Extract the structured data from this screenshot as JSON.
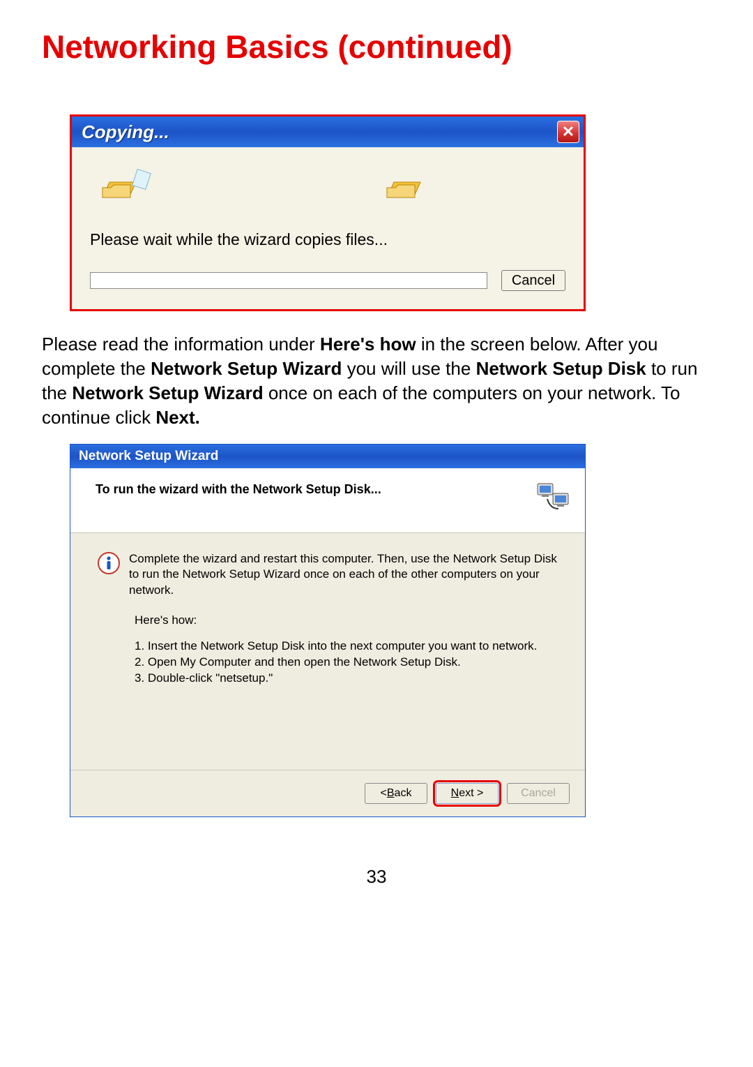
{
  "section_title": "Networking Basics (continued)",
  "copying_dialog": {
    "title": "Copying...",
    "message": "Please wait while the wizard copies files...",
    "cancel_label": "Cancel"
  },
  "paragraph": {
    "pre1": "Please read the information under ",
    "b1": "Here's how",
    "mid1": " in the screen below. After you complete the ",
    "b2": "Network Setup Wizard",
    "mid2": " you will use the ",
    "b3": "Network Setup Disk",
    "mid3": " to run the ",
    "b4": "Network Setup Wizard",
    "mid4": " once on each of the computers on your network. To continue click ",
    "b5": "Next.",
    "tail": ""
  },
  "nsw_dialog": {
    "window_title": "Network Setup Wizard",
    "header": "To run the wizard with the Network Setup Disk...",
    "info_text": "Complete the wizard and restart this computer. Then, use the Network Setup Disk to run the Network Setup Wizard once on each of the other computers on your network.",
    "heres_how": "Here's how:",
    "step1": "1.  Insert the Network Setup Disk into the next computer you want to network.",
    "step2": "2.  Open My Computer and then open the Network Setup Disk.",
    "step3": "3.  Double-click \"netsetup.\"",
    "back_label": "< Back",
    "next_label": "Next >",
    "cancel_label": "Cancel"
  },
  "page_number": "33"
}
